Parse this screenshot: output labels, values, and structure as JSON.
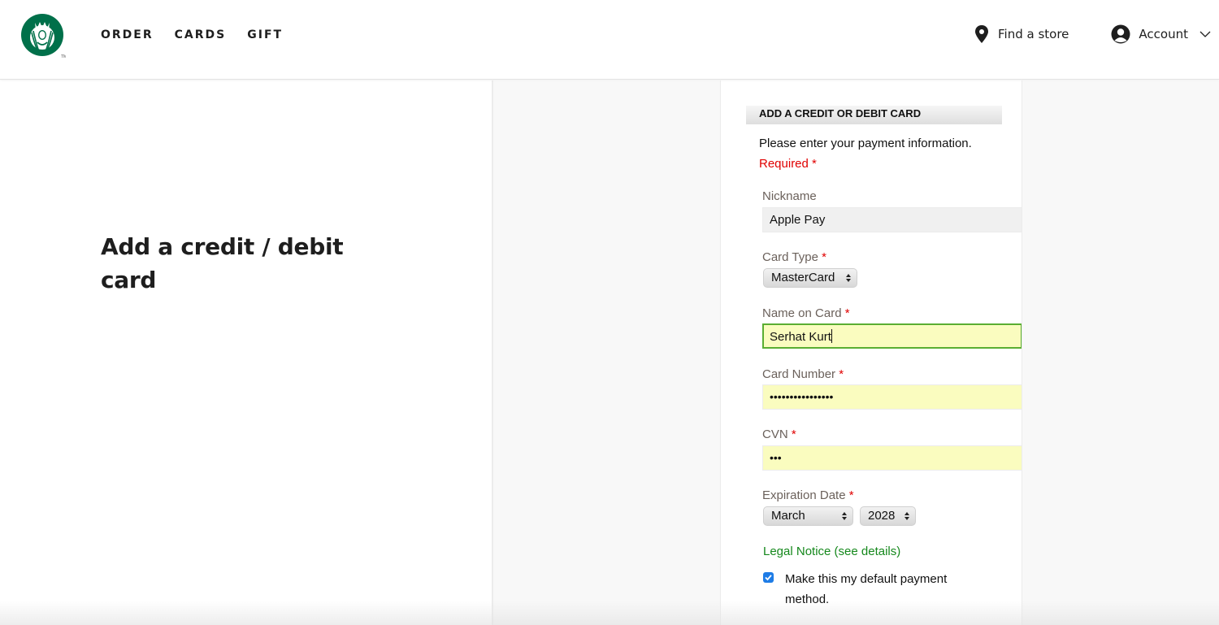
{
  "header": {
    "brand": "Starbucks",
    "nav": [
      {
        "label": "ORDER"
      },
      {
        "label": "CARDS"
      },
      {
        "label": "GIFT"
      }
    ],
    "find_store_label": "Find a store",
    "account_label": "Account",
    "icons": {
      "store": "location-pin-icon",
      "account": "user-avatar-icon",
      "account_menu": "chevron-down-icon"
    }
  },
  "page": {
    "title": "Add a credit / debit card"
  },
  "form": {
    "section_title": "ADD A CREDIT OR DEBIT CARD",
    "intro": "Please enter your payment information.",
    "required_note": "Required *",
    "nickname": {
      "label": "Nickname",
      "value": "Apple Pay"
    },
    "card_type": {
      "label": "Card Type",
      "required": "*",
      "value": "MasterCard"
    },
    "name_on_card": {
      "label": "Name on Card",
      "required": "*",
      "value": "Serhat Kurt"
    },
    "card_number": {
      "label": "Card Number",
      "required": "*",
      "value": "••••••••••••••••"
    },
    "cvn": {
      "label": "CVN",
      "required": "*",
      "value": "•••"
    },
    "expiration": {
      "label": "Expiration Date",
      "required": "*",
      "month": "March",
      "year": "2028"
    },
    "legal_notice": "Legal Notice (see details)",
    "default_payment": {
      "label": "Make this my default payment method.",
      "checked": true
    }
  },
  "colors": {
    "brand_green": "#00704a",
    "required_red": "#e00000",
    "link_green": "#15881c",
    "focus_green": "#5aae32",
    "autofill_yellow": "#fafcbf",
    "checkbox_blue": "#1e7ce6"
  }
}
